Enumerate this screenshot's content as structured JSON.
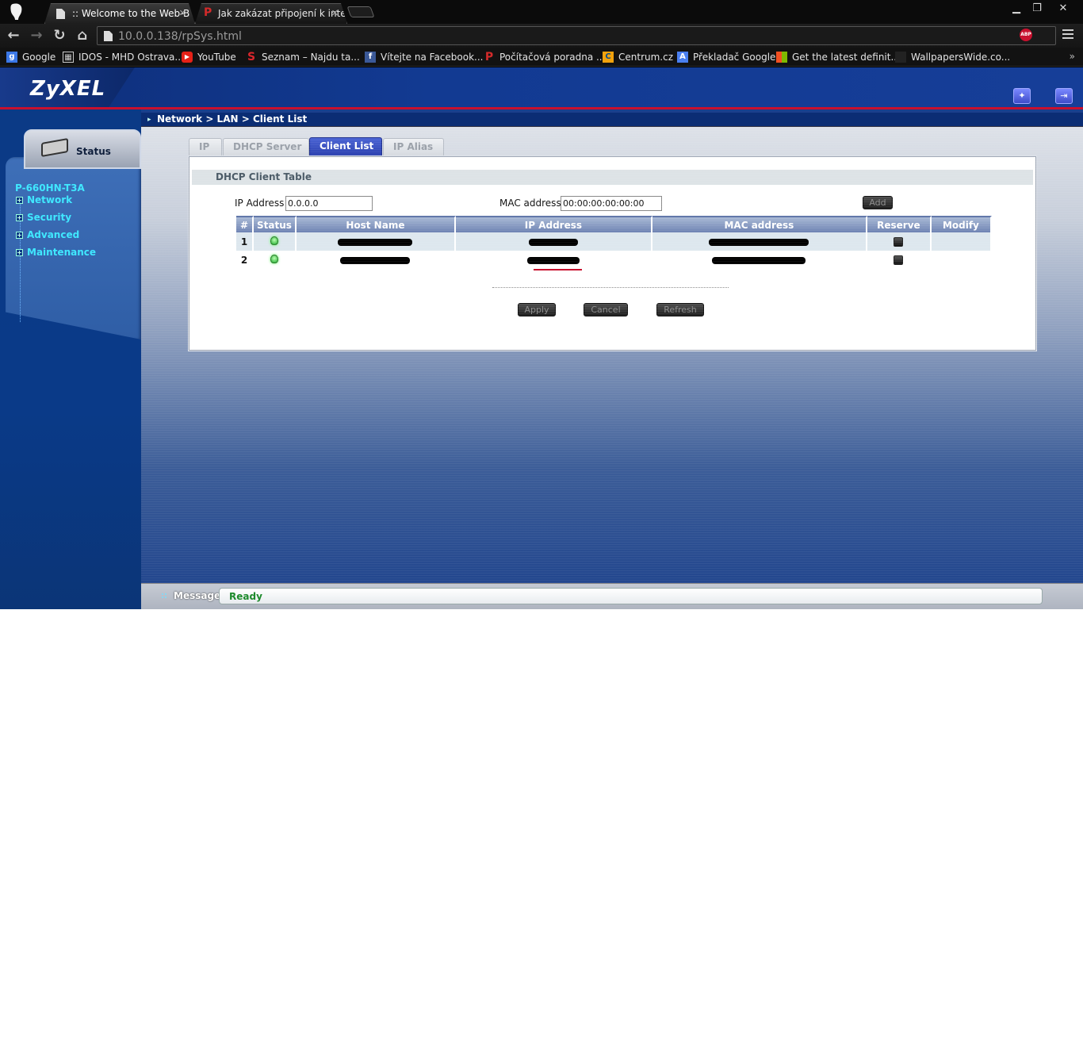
{
  "browser": {
    "tabs": [
      {
        "title": ":: Welcome to the Web-B",
        "active": true
      },
      {
        "title": "Jak zakázat připojení k inte",
        "active": false
      }
    ],
    "url": "10.0.0.138/rpSys.html",
    "bookmarks": [
      {
        "label": "Google",
        "icon": "google-icon",
        "color": "#3b78e7"
      },
      {
        "label": "IDOS - MHD Ostrava...",
        "icon": "idos-icon",
        "color": "#ffffff"
      },
      {
        "label": "YouTube",
        "icon": "youtube-icon",
        "color": "#e62117"
      },
      {
        "label": "Seznam – Najdu ta...",
        "icon": "seznam-icon",
        "color": "#d9262c"
      },
      {
        "label": "Vítejte na Facebook...",
        "icon": "facebook-icon",
        "color": "#3b5998"
      },
      {
        "label": "Počítačová poradna ...",
        "icon": "poradna-icon",
        "color": "#d42a2a"
      },
      {
        "label": "Centrum.cz",
        "icon": "centrum-icon",
        "color": "#f2a20c"
      },
      {
        "label": "Překladač Google",
        "icon": "translate-icon",
        "color": "#4a7ff0"
      },
      {
        "label": "Get the latest definit...",
        "icon": "windows-icon",
        "color": "#f25022"
      },
      {
        "label": "WallpapersWide.co...",
        "icon": "wallpapers-icon",
        "color": "#333333"
      }
    ],
    "bookmarks_more": "»",
    "adblock_badge": "ABP"
  },
  "router": {
    "brand": "ZyXEL",
    "sidebar": {
      "status_label": "Status",
      "model": "P-660HN-T3A",
      "menu": [
        {
          "label": "Network"
        },
        {
          "label": "Security"
        },
        {
          "label": "Advanced"
        },
        {
          "label": "Maintenance"
        }
      ]
    },
    "breadcrumb": "Network > LAN > Client List",
    "tabs": [
      {
        "label": "IP",
        "active": false
      },
      {
        "label": "DHCP Server",
        "active": false
      },
      {
        "label": "Client List",
        "active": true
      },
      {
        "label": "IP Alias",
        "active": false
      }
    ],
    "panel": {
      "title": "DHCP Client Table",
      "ip_label": "IP Address",
      "ip_value": "0.0.0.0",
      "mac_label": "MAC address",
      "mac_value": "00:00:00:00:00:00",
      "add_label": "Add"
    },
    "table": {
      "headers": [
        "#",
        "Status",
        "Host Name",
        "IP Address",
        "MAC address",
        "Reserve",
        "Modify"
      ],
      "rows": [
        {
          "num": "1"
        },
        {
          "num": "2"
        }
      ]
    },
    "buttons": {
      "apply": "Apply",
      "cancel": "Cancel",
      "refresh": "Refresh"
    },
    "message": {
      "label": "Message",
      "text": "Ready"
    },
    "colors": {
      "accent_red": "#c8102e",
      "menu_cyan": "#40e8ff",
      "ready_green": "#1d8a2c",
      "active_tab": "#2a3fae"
    }
  }
}
